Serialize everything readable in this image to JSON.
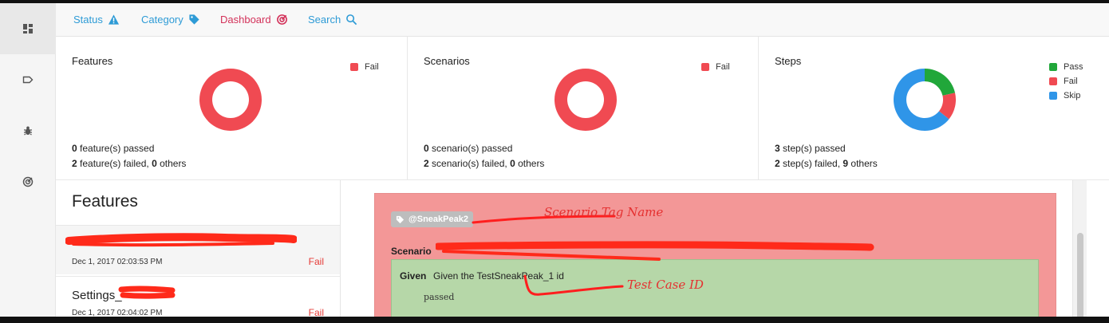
{
  "nav": {
    "links": [
      {
        "label": "Status",
        "color": "#2e9bd6",
        "icon": "warning-icon"
      },
      {
        "label": "Category",
        "color": "#2e9bd6",
        "icon": "tag-icon"
      },
      {
        "label": "Dashboard",
        "color": "#d3325a",
        "icon": "target-icon"
      },
      {
        "label": "Search",
        "color": "#2e9bd6",
        "icon": "search-icon"
      }
    ]
  },
  "rail": {
    "icons": [
      "dashboard-icon",
      "label-icon",
      "bug-icon",
      "target-icon"
    ]
  },
  "summary": {
    "features": {
      "title": "Features",
      "legend": [
        {
          "label": "Fail",
          "color": "#f04a52"
        }
      ],
      "slices": [
        {
          "label": "Fail",
          "value": 2,
          "color": "#f04a52"
        }
      ],
      "line1": {
        "count": "0",
        "text": " feature(s) passed"
      },
      "line2": {
        "count": "2",
        "text": " feature(s) failed, ",
        "others": "0",
        "others_text": " others"
      }
    },
    "scenarios": {
      "title": "Scenarios",
      "legend": [
        {
          "label": "Fail",
          "color": "#f04a52"
        }
      ],
      "slices": [
        {
          "label": "Fail",
          "value": 2,
          "color": "#f04a52"
        }
      ],
      "line1": {
        "count": "0",
        "text": " scenario(s) passed"
      },
      "line2": {
        "count": "2",
        "text": " scenario(s) failed, ",
        "others": "0",
        "others_text": " others"
      }
    },
    "steps": {
      "title": "Steps",
      "legend": [
        {
          "label": "Pass",
          "color": "#21a73a"
        },
        {
          "label": "Fail",
          "color": "#f04a52"
        },
        {
          "label": "Skip",
          "color": "#2f95e8"
        }
      ],
      "slices": [
        {
          "label": "Pass",
          "value": 3,
          "color": "#21a73a"
        },
        {
          "label": "Fail",
          "value": 2,
          "color": "#f04a52"
        },
        {
          "label": "Skip",
          "value": 9,
          "color": "#2f95e8"
        }
      ],
      "line1": {
        "count": "3",
        "text": " step(s) passed"
      },
      "line2": {
        "count": "2",
        "text": " step(s) failed, ",
        "others": "9",
        "others_text": " others"
      }
    }
  },
  "features_list": {
    "heading": "Features",
    "items": [
      {
        "name": "",
        "date": "Dec 1, 2017 02:03:53 PM",
        "status": "Fail"
      },
      {
        "name": "Settings_",
        "date": "Dec 1, 2017 02:04:02 PM",
        "status": "Fail"
      }
    ]
  },
  "scenario": {
    "tag": "@SneakPeak2",
    "label": "Scenario",
    "step": {
      "keyword": "Given",
      "text": "Given the TestSneakPeak_1 id",
      "result": "passed"
    }
  },
  "annotations": {
    "tag_note": "Scenario Tag Name",
    "id_note": "Test Case ID"
  }
}
